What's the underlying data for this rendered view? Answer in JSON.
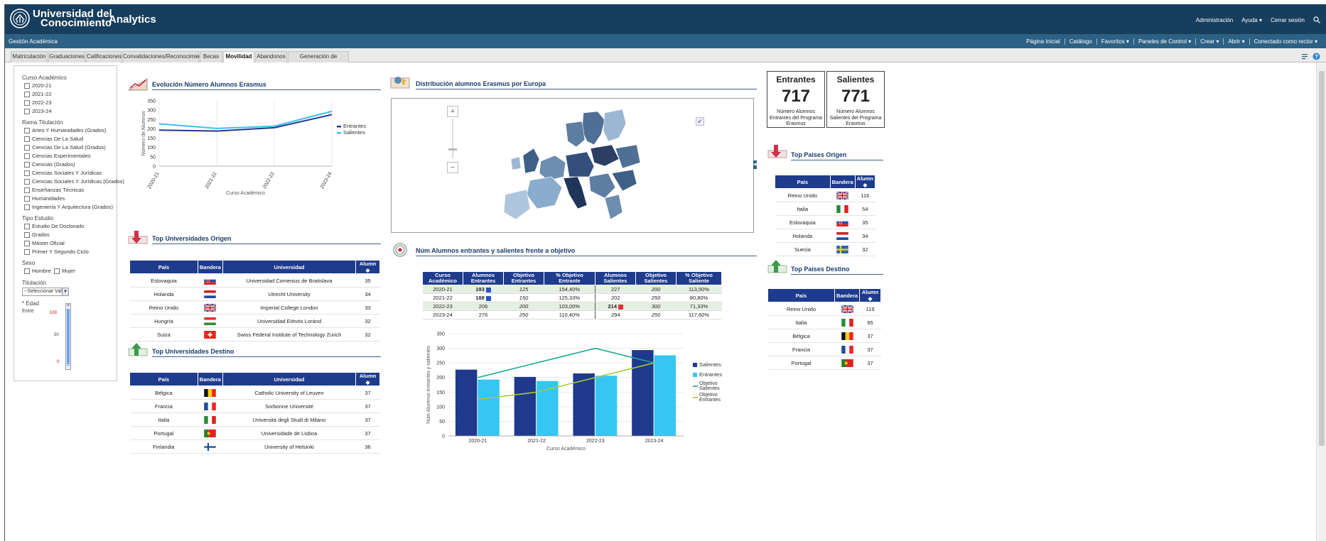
{
  "header": {
    "uni_line1": "Universidad del",
    "uni_line2": "Conocimiento",
    "app": "Analytics",
    "links": [
      "Administración",
      "Ayuda ▾",
      "Cerrar sesión"
    ]
  },
  "subbar": {
    "title": "Gestión Académica",
    "menu": [
      "Página Inicial",
      "Catálogo",
      "Favoritos ▾",
      "Paneles de Control ▾",
      "Crear ▾",
      "Abrir ▾",
      "Conectado como  rector ▾"
    ]
  },
  "tabs": [
    "Matriculación",
    "Graduaciones",
    "Calificaciones",
    "Convalidaciones/Reconocimiento",
    "Becas",
    "Movilidad",
    "Abandonos",
    "Generación de informes"
  ],
  "filters": {
    "curso_title": "Curso Académico",
    "cursos": [
      "2020-21",
      "2021-22",
      "2022-23",
      "2023-24"
    ],
    "rama_title": "Rama Titulación",
    "ramas": [
      "Artes Y Humanidades (Grados)",
      "Ciencias De La Salud",
      "Ciencias De La Salud (Grados)",
      "Ciencias Experimentales",
      "Ciencias (Grados)",
      "Ciencias Sociales Y Jurídicas",
      "Ciencias Sociales Y Jurídicas (Grados)",
      "Enseñanzas Técnicas",
      "Humanidades",
      "Ingeniería Y Arquitectura (Grados)"
    ],
    "tipo_title": "Tipo Estudio",
    "tipos": [
      "Estudio De Doctorado",
      "Grados",
      "Máster Oficial",
      "Primer Y Segundo Ciclo"
    ],
    "sexo_title": "Sexo",
    "sexo": [
      "Hombre",
      "Mujer"
    ],
    "titulacion_title": "Titulación",
    "titulacion_value": "--Seleccionar Valor",
    "edad_title": "* Edad",
    "entre": "Entre",
    "slider_max": "100",
    "slider_mid": "50",
    "slider_min": "0",
    "edad_range": [
      0,
      100
    ]
  },
  "sections": {
    "evolucion": "Evolución Número Alumnos Erasmus",
    "distribucion": "Distribución alumnos Erasmus por Europa",
    "top_uni_origen": "Top Universidades Origen",
    "top_uni_destino": "Top Universidades Destino",
    "objetivo": "Núm Alumnos entrantes y salientes frente a objetivo",
    "top_paises_origen": "Top Paises Origen",
    "top_paises_destino": "Top Paises Destino"
  },
  "kpi": {
    "entrantes_title": "Entrantes",
    "entrantes_value": "717",
    "entrantes_sub": "Número Alumnos Entrantes del Programa Erasmus",
    "salientes_title": "Salientes",
    "salientes_value": "771",
    "salientes_sub": "Número Alumnos Salientes del Programa Erasmus"
  },
  "uni_cols": [
    "País",
    "Bandera",
    "Universidad",
    "Alumn"
  ],
  "uni_origen": [
    {
      "pais": "Eslovaquia",
      "flag": "sk",
      "uni": "Universidad Comenius de Bratislava",
      "n": "35"
    },
    {
      "pais": "Holanda",
      "flag": "nl",
      "uni": "Utrecht University",
      "n": "34"
    },
    {
      "pais": "Reino Unido",
      "flag": "gb",
      "uni": "Imperial College London",
      "n": "33"
    },
    {
      "pais": "Hungría",
      "flag": "hu",
      "uni": "Universidad Eötvös Loránd",
      "n": "32"
    },
    {
      "pais": "Suiza",
      "flag": "ch",
      "uni": "Swiss Federal Institute of Technology Zurich",
      "n": "32"
    }
  ],
  "uni_destino": [
    {
      "pais": "Bélgica",
      "flag": "be",
      "uni": "Catholic University of Leuven",
      "n": "37"
    },
    {
      "pais": "Francia",
      "flag": "fr",
      "uni": "Sorbonne Université",
      "n": "37"
    },
    {
      "pais": "Italia",
      "flag": "it",
      "uni": "Università degli Studi di Milano",
      "n": "37"
    },
    {
      "pais": "Portugal",
      "flag": "pt",
      "uni": "Universidade de Lisboa",
      "n": "37"
    },
    {
      "pais": "Finlandia",
      "flag": "fi",
      "uni": "University of Helsinki",
      "n": "36"
    }
  ],
  "pais_cols": [
    "País",
    "Bandera",
    "Alumn"
  ],
  "paises_origen": [
    {
      "pais": "Reino Unido",
      "flag": "gb",
      "n": "116"
    },
    {
      "pais": "Italia",
      "flag": "it",
      "n": "54"
    },
    {
      "pais": "Eslovaquia",
      "flag": "sk",
      "n": "35"
    },
    {
      "pais": "Holanda",
      "flag": "nl",
      "n": "34"
    },
    {
      "pais": "Suecia",
      "flag": "se",
      "n": "32"
    }
  ],
  "paises_destino": [
    {
      "pais": "Reino Unido",
      "flag": "gb",
      "n": "119"
    },
    {
      "pais": "Italia",
      "flag": "it",
      "n": "65"
    },
    {
      "pais": "Bélgica",
      "flag": "be",
      "n": "37"
    },
    {
      "pais": "Francia",
      "flag": "fr",
      "n": "37"
    },
    {
      "pais": "Portugal",
      "flag": "pt",
      "n": "37"
    }
  ],
  "obj_cols": [
    "Curso Académico",
    "Alumnos Entrantes",
    "Objetivo Entrantes",
    "% Objetivo Entrante",
    "Alumnos Salientes",
    "Objetivo Salientes",
    "% Objetivo Saliente"
  ],
  "obj_rows": [
    {
      "c": "2020-21",
      "ae": "193",
      "oe": "125",
      "pe": "154,40%",
      "as": "227",
      "os": "200",
      "ps": "113,50%",
      "mark": "ae",
      "markc": "#2b55c4"
    },
    {
      "c": "2021-22",
      "ae": "188",
      "oe": "150",
      "pe": "125,33%",
      "as": "202",
      "os": "250",
      "ps": "80,80%",
      "mark": "ae",
      "markc": "#2b55c4"
    },
    {
      "c": "2022-23",
      "ae": "206",
      "oe": "200",
      "pe": "103,00%",
      "as": "214",
      "os": "300",
      "ps": "71,33%",
      "mark": "as",
      "markc": "#d33"
    },
    {
      "c": "2023-24",
      "ae": "276",
      "oe": "250",
      "pe": "110,40%",
      "as": "294",
      "os": "250",
      "ps": "117,60%",
      "mark": "",
      "markc": ""
    }
  ],
  "chart_data": [
    {
      "type": "line",
      "title": "Evolución Número Alumnos Erasmus",
      "xlabel": "Curso Académico",
      "ylabel": "Número de Alumnos",
      "categories": [
        "2020-21",
        "2021-22",
        "2022-23",
        "2023-24"
      ],
      "ylim": [
        0,
        350
      ],
      "yticks": [
        0,
        50,
        100,
        150,
        200,
        250,
        300,
        350
      ],
      "grid": "vertical",
      "legend": "right",
      "series": [
        {
          "name": "Entrantes",
          "values": [
            193,
            188,
            206,
            276
          ],
          "color": "#1f3a8c"
        },
        {
          "name": "Salientes",
          "values": [
            227,
            202,
            214,
            294
          ],
          "color": "#3cc0f0"
        }
      ]
    },
    {
      "type": "bar",
      "xlabel": "Curso Académico",
      "ylabel": "Núm Alumnos entrantes y salientes",
      "categories": [
        "2020-21",
        "2021-22",
        "2022-23",
        "2023-24"
      ],
      "ylim": [
        0,
        350
      ],
      "yticks": [
        0,
        50,
        100,
        150,
        200,
        250,
        300,
        350
      ],
      "grid": "horizontal",
      "legend": "right",
      "series": [
        {
          "name": "Salientes",
          "kind": "bar",
          "values": [
            227,
            202,
            214,
            294
          ],
          "color": "#1f3a8c"
        },
        {
          "name": "Entrantes",
          "kind": "bar",
          "values": [
            193,
            188,
            206,
            276
          ],
          "color": "#35c6f4"
        },
        {
          "name": "Objetivo Salientes",
          "kind": "line",
          "values": [
            200,
            250,
            300,
            250
          ],
          "color": "#1aa898"
        },
        {
          "name": "Objetivo Entrantes",
          "kind": "line",
          "values": [
            125,
            150,
            200,
            250
          ],
          "color": "#a6c93a"
        }
      ]
    }
  ]
}
